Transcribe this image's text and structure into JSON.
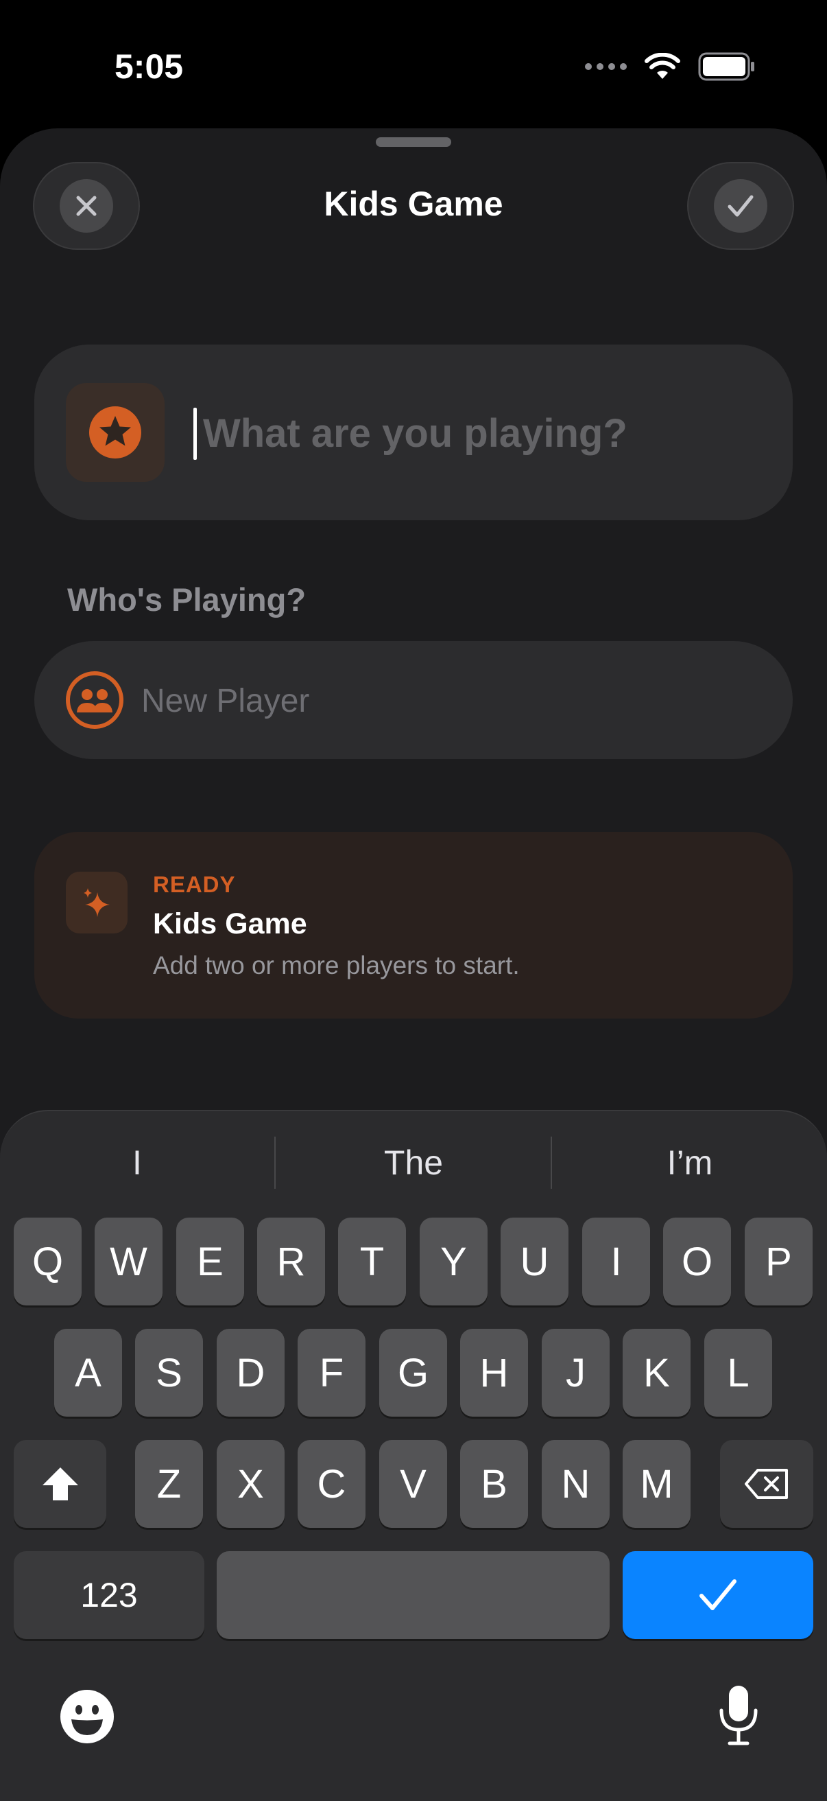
{
  "status_bar": {
    "time": "5:05"
  },
  "sheet": {
    "title": "Kids Game"
  },
  "game_name": {
    "placeholder": "What are you playing?",
    "value": ""
  },
  "players": {
    "section_label": "Who's Playing?",
    "new_player_placeholder": "New Player"
  },
  "ready_card": {
    "tag": "READY",
    "title": "Kids Game",
    "subtitle": "Add two or more players to start."
  },
  "keyboard": {
    "suggestions": [
      "I",
      "The",
      "I’m"
    ],
    "row1": [
      "Q",
      "W",
      "E",
      "R",
      "T",
      "Y",
      "U",
      "I",
      "O",
      "P"
    ],
    "row2": [
      "A",
      "S",
      "D",
      "F",
      "G",
      "H",
      "J",
      "K",
      "L"
    ],
    "row3": [
      "Z",
      "X",
      "C",
      "V",
      "B",
      "N",
      "M"
    ],
    "numbers_label": "123"
  },
  "colors": {
    "accent": "#d45f24",
    "return_key": "#0a84ff",
    "sheet_bg": "#1c1c1e",
    "card_bg": "#2c2c2e"
  }
}
